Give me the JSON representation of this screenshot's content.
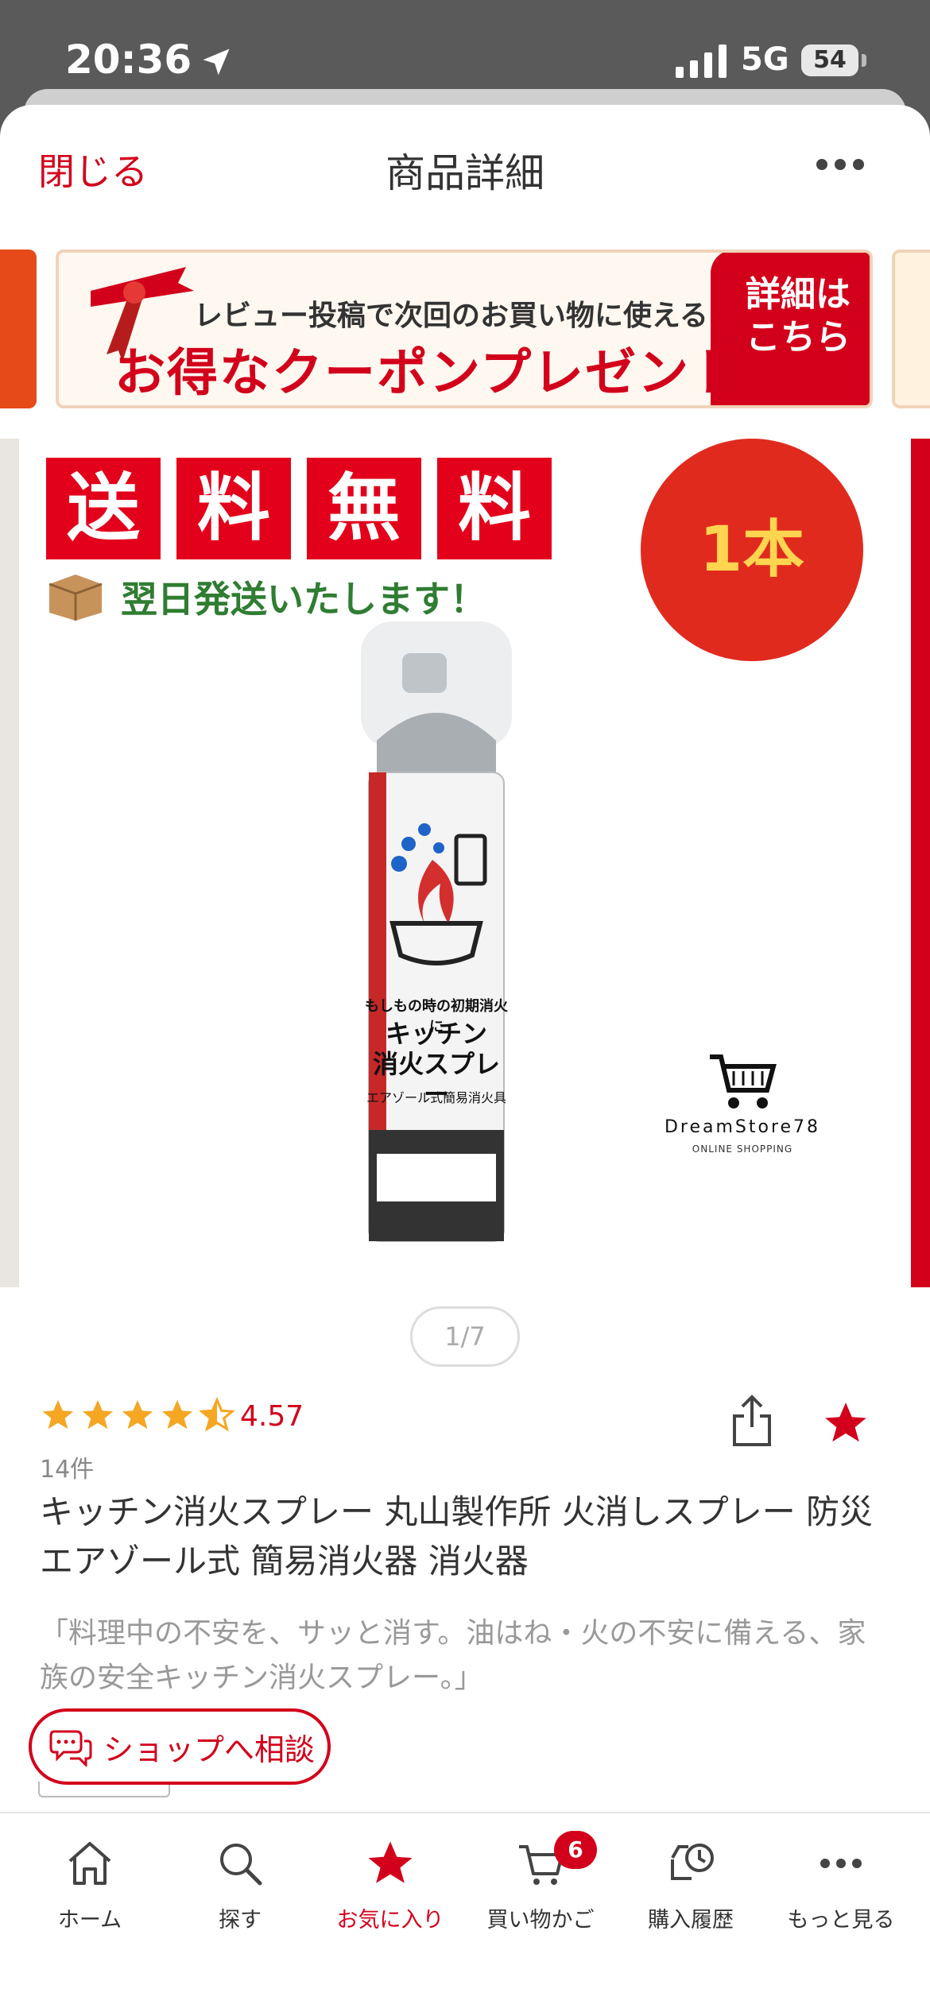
{
  "status_bar": {
    "time": "20:36",
    "network": "5G",
    "battery": "54"
  },
  "nav": {
    "close_label": "閉じる",
    "title": "商品詳細"
  },
  "banner": {
    "line1": "レビュー投稿で次回のお買い物に使える",
    "line2": "お得なクーポンプレゼント!!",
    "button": "詳細はこちら"
  },
  "product_image": {
    "free_shipping": [
      "送",
      "料",
      "無",
      "料"
    ],
    "next_day": "翌日発送いたします！",
    "count": "1本",
    "can_top": "もしもの時の初期消火に",
    "can_main_1": "キッチン",
    "can_main_2": "消火スプレー",
    "can_sub": "エアゾール式簡易消火具",
    "store_name": "DreamStore78",
    "store_sub": "ONLINE SHOPPING"
  },
  "pager": "1/7",
  "rating": {
    "value": "4.57",
    "stars": 4.5,
    "reviews": "14件"
  },
  "product": {
    "title": "キッチン消火スプレー 丸山製作所 火消しスプレー 防災 エアゾール式 簡易消火器 消火器",
    "catch": "「料理中の不安を、サッと消す。油はね・火の不安に備える、家族の安全キッチン消火スプレー。」"
  },
  "chat_button": "ショップへ相談",
  "tabs": [
    {
      "label": "ホーム",
      "icon": "home-icon"
    },
    {
      "label": "探す",
      "icon": "search-icon"
    },
    {
      "label": "お気に入り",
      "icon": "star-icon"
    },
    {
      "label": "買い物かご",
      "icon": "cart-icon",
      "badge": "6"
    },
    {
      "label": "購入履歴",
      "icon": "history-icon"
    },
    {
      "label": "もっと見る",
      "icon": "more-icon"
    }
  ],
  "colors": {
    "accent": "#d3001b",
    "star": "#f5a623"
  }
}
